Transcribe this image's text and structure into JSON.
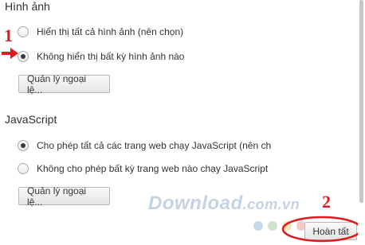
{
  "images": {
    "title": "Hình ảnh",
    "options": [
      {
        "label": "Hiển thị tất cả hình ảnh (nên chọn)",
        "selected": false
      },
      {
        "label": "Không hiển thị bất kỳ hình ảnh nào",
        "selected": true
      }
    ],
    "exceptions_button": "Quản lý ngoại lệ..."
  },
  "javascript": {
    "title": "JavaScript",
    "options": [
      {
        "label": "Cho phép tất cả các trang web chạy JavaScript (nên ch",
        "selected": true
      },
      {
        "label": "Không cho phép bất kỳ trang web nào chạy JavaScript",
        "selected": false
      }
    ],
    "exceptions_button": "Quản lý ngoại lệ..."
  },
  "done_button": "Hoàn tất",
  "annotations": {
    "step1": "1",
    "step2": "2"
  },
  "watermark": {
    "main": "Download",
    "suffix": ".com.vn"
  },
  "colors": {
    "annotation": "#e0191e",
    "watermark_dots": [
      "#c7d9ec",
      "#cfe4cf",
      "#f6e6b8",
      "#f3c9c9"
    ]
  }
}
